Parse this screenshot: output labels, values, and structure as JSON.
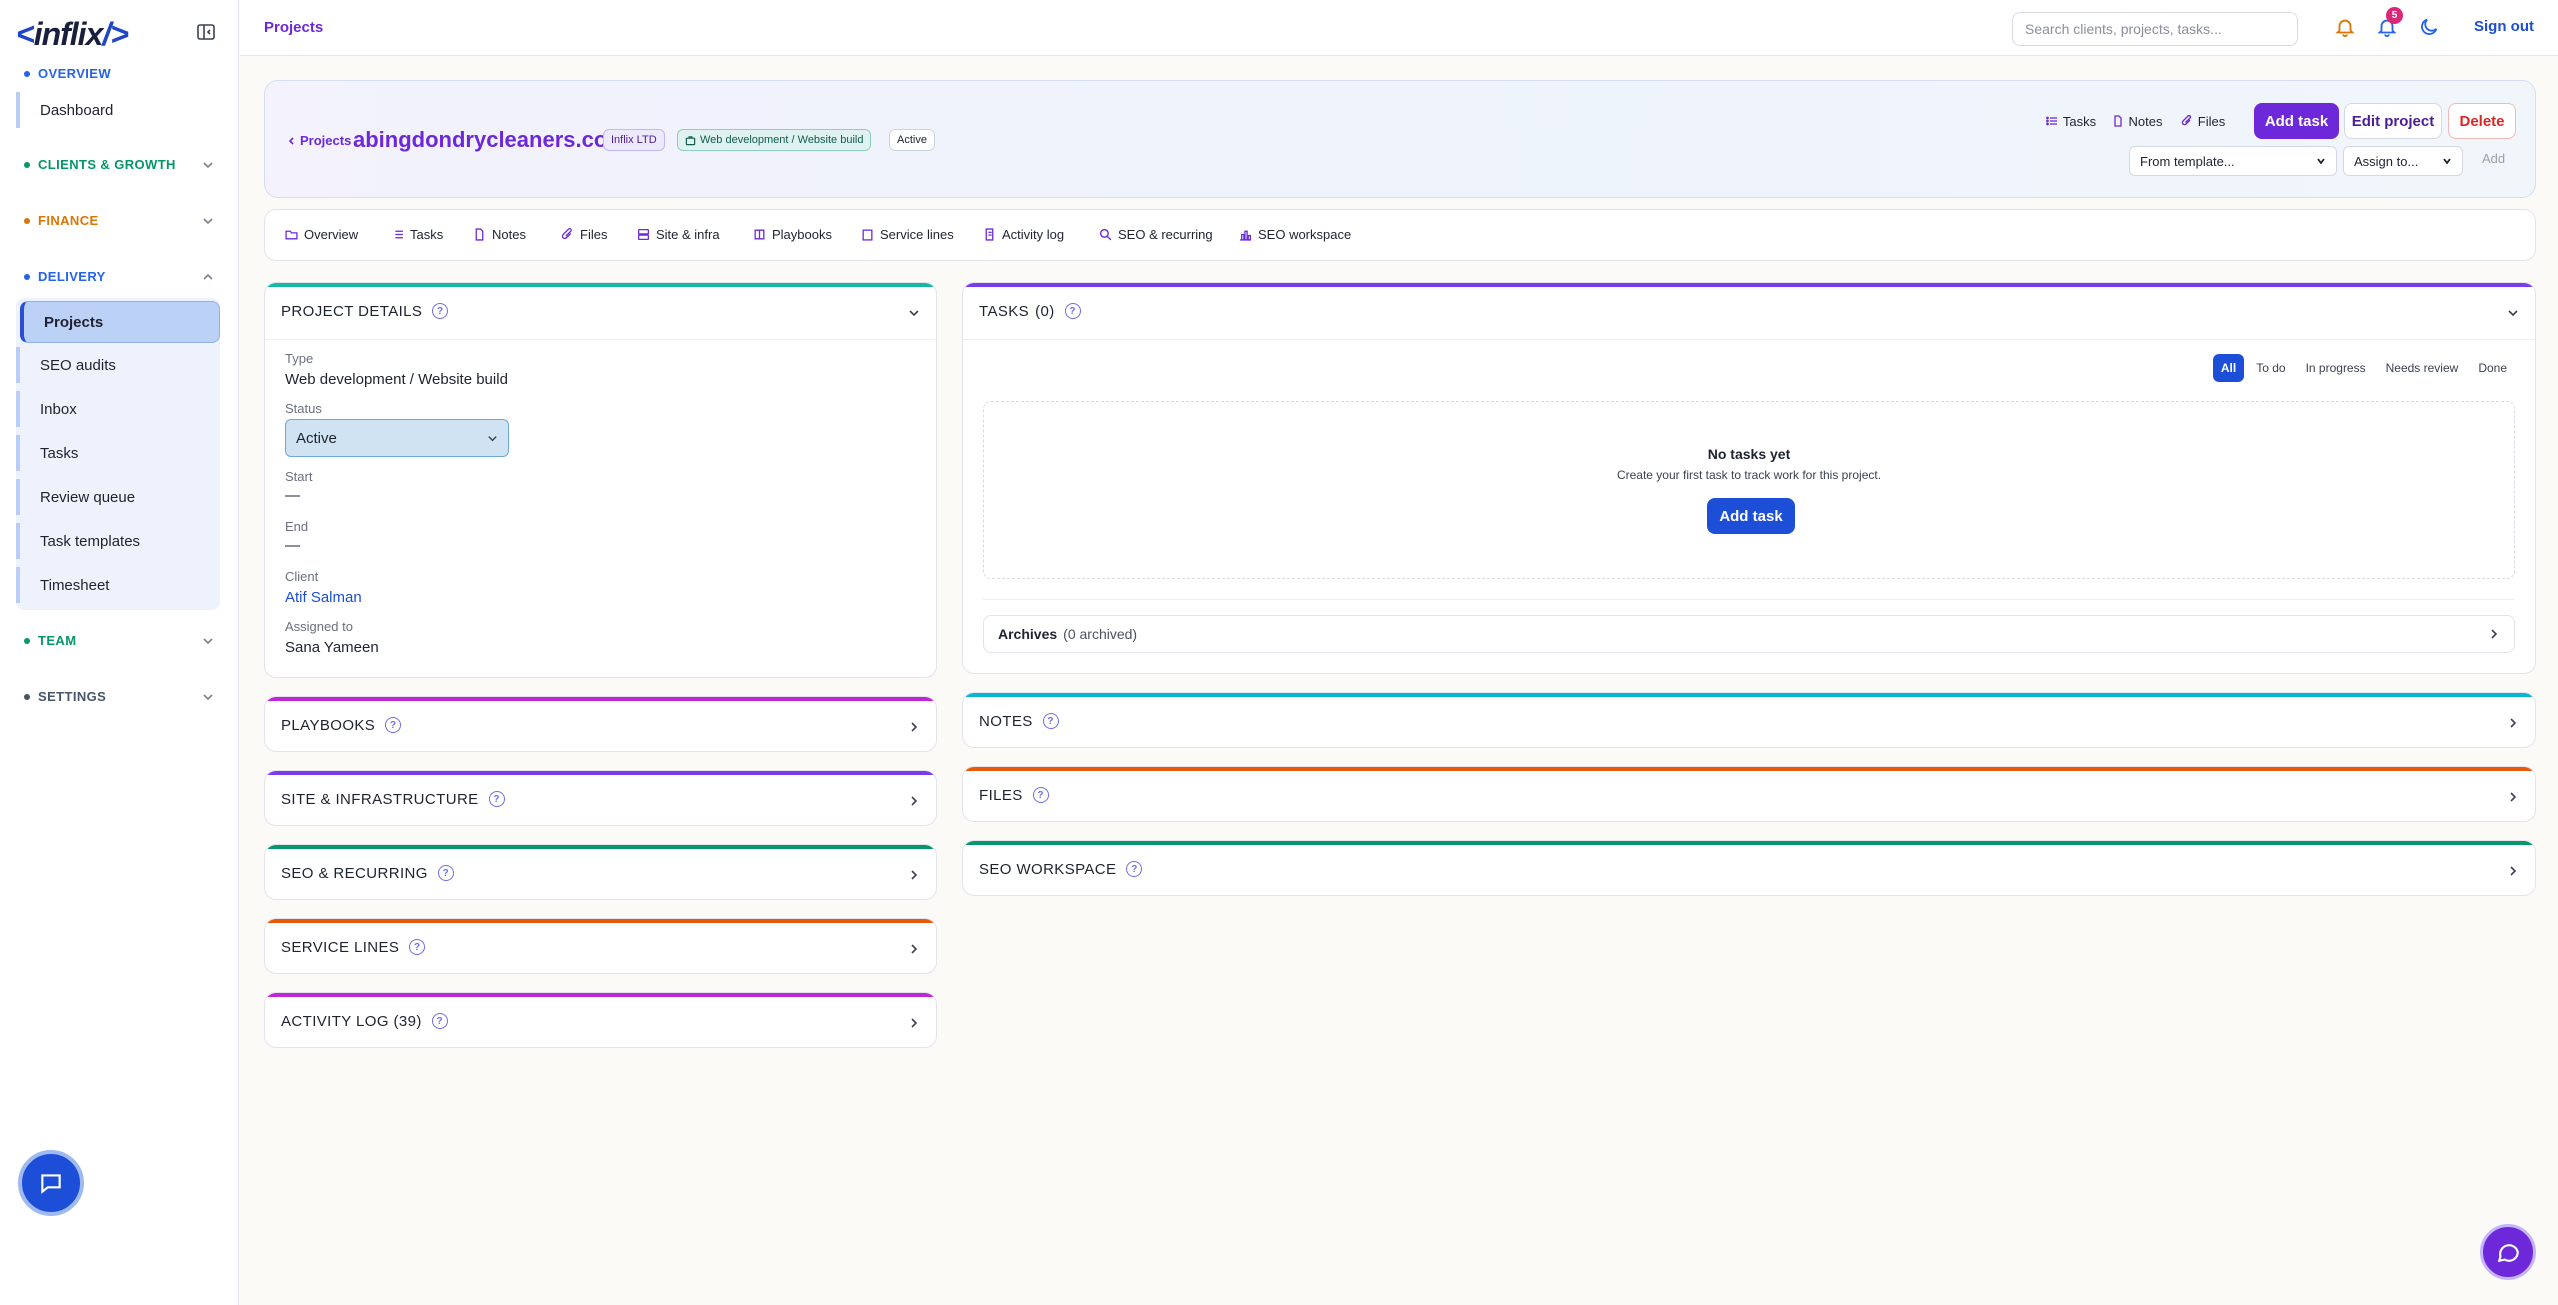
{
  "brand": {
    "logo_open": "<",
    "logo_text": "inflix",
    "logo_close": "/>"
  },
  "sidebar": {
    "sections": {
      "overview": "OVERVIEW",
      "clients": "CLIENTS & GROWTH",
      "finance": "FINANCE",
      "delivery": "DELIVERY",
      "team": "TEAM",
      "settings": "SETTINGS"
    },
    "overview_items": [
      "Dashboard"
    ],
    "delivery_items": [
      "Projects",
      "SEO audits",
      "Inbox",
      "Tasks",
      "Review queue",
      "Task templates",
      "Timesheet"
    ],
    "active_item": "Projects",
    "colors": {
      "overview": "#2563eb",
      "clients": "#059669",
      "finance": "#d97706",
      "delivery": "#2563eb",
      "team": "#059669",
      "settings": "#475569"
    }
  },
  "topbar": {
    "breadcrumb": "Projects",
    "search_placeholder": "Search clients, projects, tasks...",
    "notification_count": "5",
    "signout": "Sign out"
  },
  "project": {
    "back_label": "Projects",
    "title": "abingdondrycleaners.co.uk",
    "org_chip": "Inflix LTD",
    "type_chip": "Web development / Website build",
    "status_chip": "Active",
    "actions": {
      "tasks": "Tasks",
      "notes": "Notes",
      "files": "Files",
      "add_task": "Add task",
      "edit": "Edit project",
      "delete": "Delete"
    },
    "template_select": "From template...",
    "assign_select": "Assign to...",
    "add_label": "Add"
  },
  "tabs": [
    "Overview",
    "Tasks",
    "Notes",
    "Files",
    "Site & infra",
    "Playbooks",
    "Service lines",
    "Activity log",
    "SEO & recurring",
    "SEO workspace"
  ],
  "details": {
    "heading": "PROJECT DETAILS",
    "type_label": "Type",
    "type_value": "Web development / Website build",
    "status_label": "Status",
    "status_value": "Active",
    "start_label": "Start",
    "start_value": "—",
    "end_label": "End",
    "end_value": "—",
    "client_label": "Client",
    "client_value": "Atif Salman",
    "assigned_label": "Assigned to",
    "assigned_value": "Sana Yameen"
  },
  "left_panels": [
    {
      "title": "PLAYBOOKS",
      "color": "#c026d3"
    },
    {
      "title": "SITE & INFRASTRUCTURE",
      "color": "#7c3aed"
    },
    {
      "title": "SEO & RECURRING",
      "color": "#059669"
    },
    {
      "title": "SERVICE LINES",
      "color": "#ea580c"
    },
    {
      "title": "ACTIVITY LOG (39)",
      "color": "#c026d3"
    }
  ],
  "tasks_panel": {
    "heading": "TASKS",
    "count": "(0)",
    "filters": [
      "All",
      "To do",
      "In progress",
      "Needs review",
      "Done"
    ],
    "selected_filter": "All",
    "empty_title": "No tasks yet",
    "empty_sub": "Create your first task to track work for this project.",
    "empty_button": "Add task",
    "archives_label": "Archives",
    "archives_count": "(0 archived)"
  },
  "right_panels": [
    {
      "title": "NOTES",
      "color": "#06b6d4"
    },
    {
      "title": "FILES",
      "color": "#ea580c"
    },
    {
      "title": "SEO WORKSPACE",
      "color": "#059669"
    }
  ],
  "panel_colors": {
    "details": "#14b8a6",
    "tasks": "#7c3aed"
  }
}
